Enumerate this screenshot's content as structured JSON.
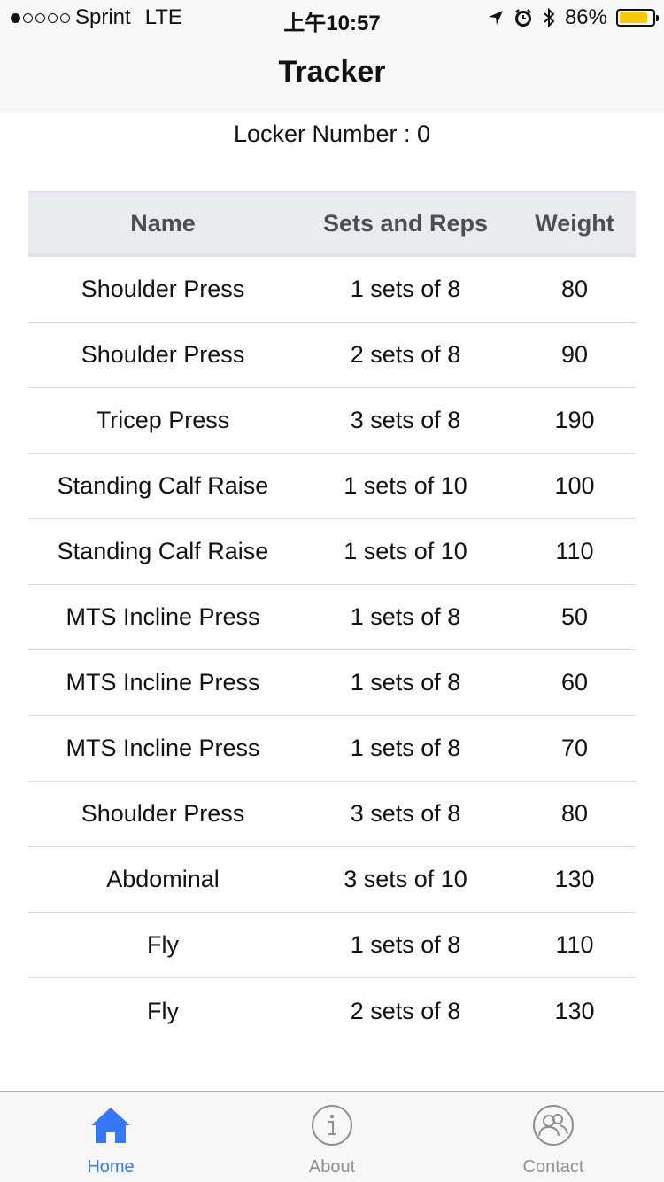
{
  "status_bar": {
    "carrier": "Sprint",
    "network": "LTE",
    "time": "上午10:57",
    "battery_percent": "86%",
    "battery_level": 0.86,
    "battery_color": "#f8c800"
  },
  "nav": {
    "title": "Tracker"
  },
  "locker": {
    "text": "Locker Number : 0"
  },
  "table": {
    "headers": {
      "name": "Name",
      "sets": "Sets and Reps",
      "weight": "Weight"
    },
    "rows": [
      {
        "name": "Shoulder Press",
        "sets": "1 sets of 8",
        "weight": "80"
      },
      {
        "name": "Shoulder Press",
        "sets": "2 sets of 8",
        "weight": "90"
      },
      {
        "name": "Tricep Press",
        "sets": "3 sets of 8",
        "weight": "190"
      },
      {
        "name": "Standing Calf Raise",
        "sets": "1 sets of 10",
        "weight": "100"
      },
      {
        "name": "Standing Calf Raise",
        "sets": "1 sets of 10",
        "weight": "110"
      },
      {
        "name": "MTS Incline Press",
        "sets": "1 sets of 8",
        "weight": "50"
      },
      {
        "name": "MTS Incline Press",
        "sets": "1 sets of 8",
        "weight": "60"
      },
      {
        "name": "MTS Incline Press",
        "sets": "1 sets of 8",
        "weight": "70"
      },
      {
        "name": "Shoulder Press",
        "sets": "3 sets of 8",
        "weight": "80"
      },
      {
        "name": "Abdominal",
        "sets": "3 sets of 10",
        "weight": "130"
      },
      {
        "name": "Fly",
        "sets": "1 sets of 8",
        "weight": "110"
      },
      {
        "name": "Fly",
        "sets": "2 sets of 8",
        "weight": "130"
      }
    ]
  },
  "tab_bar": {
    "accent_color": "#3478f6",
    "inactive_color": "#8e8e93",
    "tabs": [
      {
        "label": "Home",
        "icon": "home-icon",
        "active": true
      },
      {
        "label": "About",
        "icon": "info-icon",
        "active": false
      },
      {
        "label": "Contact",
        "icon": "contact-icon",
        "active": false
      }
    ]
  }
}
